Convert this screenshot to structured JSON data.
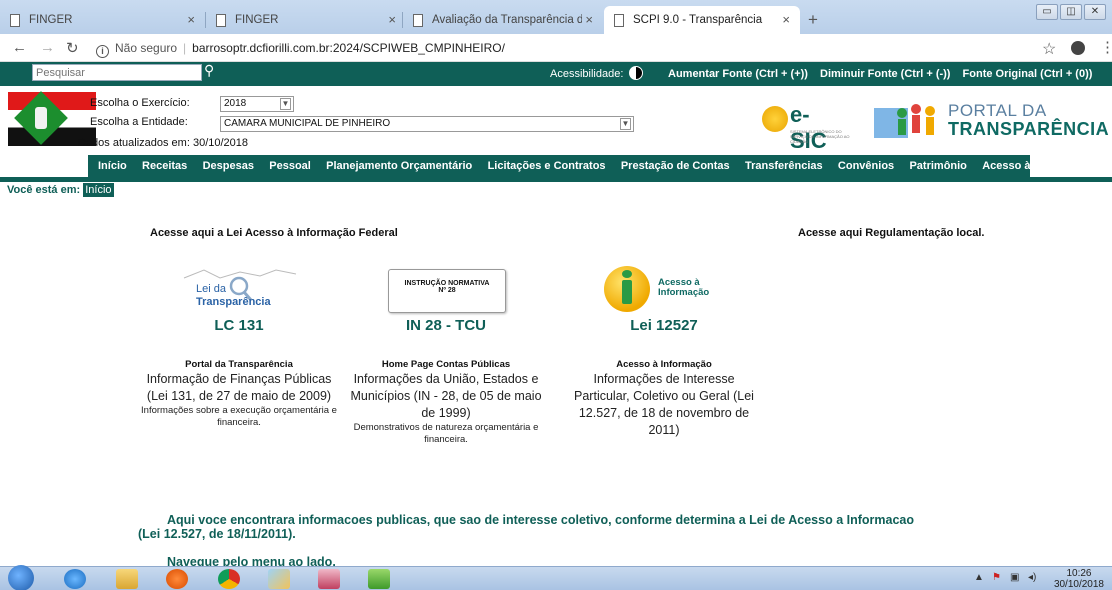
{
  "browser": {
    "tabs": [
      {
        "title": "FINGER"
      },
      {
        "title": "FINGER"
      },
      {
        "title": "Avaliação da Transparência dos"
      },
      {
        "title": "SCPI 9.0 - Transparência"
      }
    ],
    "address": {
      "security": "Não seguro",
      "url": "barrosoptr.dcfiorilli.com.br:2024/SCPIWEB_CMPINHEIRO/"
    }
  },
  "topbar": {
    "search_placeholder": "Pesquisar",
    "accessibility_label": "Acessibilidade:",
    "font_links": [
      "Aumentar Fonte (Ctrl + (+))",
      "Diminuir Fonte (Ctrl + (-))",
      "Fonte Original (Ctrl + (0))"
    ]
  },
  "header": {
    "exercise_label": "Escolha o Exercício:",
    "exercise_value": "2018",
    "entity_label": "Escolha a Entidade:",
    "entity_value": "CAMARA MUNICIPAL DE PINHEIRO",
    "updated": "Dados atualizados em: 30/10/2018",
    "esic": "e-SIC",
    "esic_sub": "SISTEMA ELETRÔNICO DO SERVIÇO DE INFORMAÇÃO AO CIDADÃO",
    "portal_line1": "PORTAL DA",
    "portal_line2": "TRANSPARÊNCIA"
  },
  "menu": [
    "Início",
    "Receitas",
    "Despesas",
    "Pessoal",
    "Planejamento Orçamentário",
    "Licitações e Contratos",
    "Prestação de Contas",
    "Transferências",
    "Convênios",
    "Patrimônio",
    "Acesso à Informação"
  ],
  "breadcrumb": {
    "label": "Você está em:",
    "home": "Início"
  },
  "content": {
    "federal_link": "Acesse aqui a Lei Acesso à Informação Federal",
    "local_link": "Acesse aqui Regulamentação local.",
    "columns": [
      {
        "logo_text_1": "Lei da",
        "logo_text_2": "Transparência",
        "code": "LC 131",
        "title": "Portal da Transparência",
        "description": "Informação de Finanças Públicas (Lei 131, de 27 de maio de 2009)",
        "note": "Informações sobre a execução orçamentária e financeira."
      },
      {
        "logo_text_1": "INSTRUÇÃO NORMATIVA",
        "logo_text_2": "Nº 28",
        "code": "IN 28 - TCU",
        "title": "Home Page Contas Públicas",
        "description": "Informações da União, Estados e Municípios (IN - 28, de 05 de maio de 1999)",
        "note": "Demonstrativos de natureza orçamentária e financeira."
      },
      {
        "logo_text_1": "Acesso à",
        "logo_text_2": "Informação",
        "code": "Lei 12527",
        "title": "Acesso à Informação",
        "description": "Informações de Interesse Particular, Coletivo ou Geral (Lei 12.527, de 18 de novembro de 2011)",
        "note": ""
      }
    ],
    "info_line1": "Aqui voce encontrara informacoes publicas, que sao de interesse coletivo, conforme determina a Lei de Acesso a Informacao",
    "info_line2": "(Lei 12.527, de 18/11/2011).",
    "navigate": "Navegue pelo menu ao lado."
  },
  "taskbar": {
    "time": "10:26",
    "date": "30/10/2018"
  },
  "colors": {
    "brand": "#0f5f57",
    "accent_yellow": "#f0a900",
    "portal_blue": "#5a7fa0"
  }
}
